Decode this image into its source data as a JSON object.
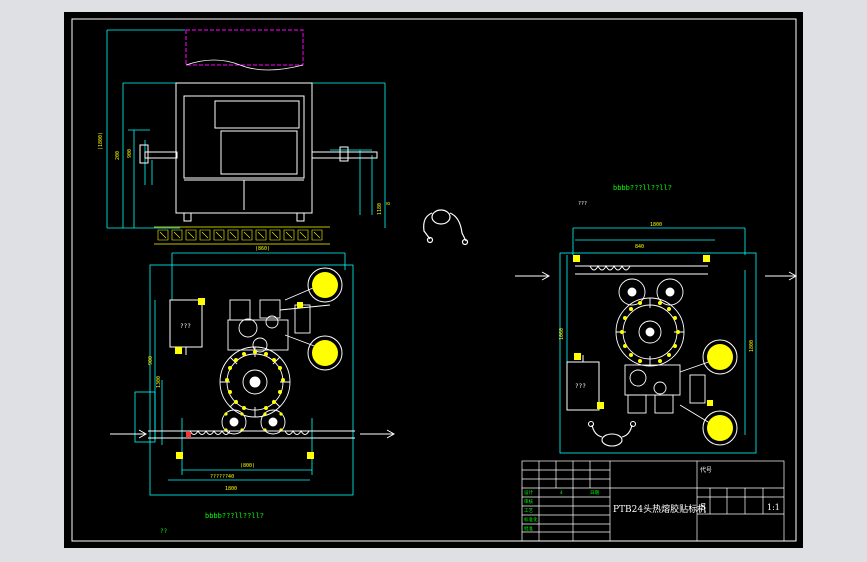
{
  "colors": {
    "background": "#dfe0e4",
    "sheet": "#000000",
    "white": "#ffffff",
    "cyan": "#00ffff",
    "green": "#00ff00",
    "yellow": "#ffff00",
    "magenta": "#ff00ff",
    "red": "#ff3030"
  },
  "drawing": {
    "machine_name": "PTB24头热熔胶贴标机",
    "scale": "1:1",
    "stage_mark": "S",
    "title_block_header": "代号",
    "unknown_label": "???"
  },
  "view_labels": {
    "top_view_right": "bbbb???ll??ll?",
    "top_view_left": "bbbb???ll??ll?",
    "small_left_mark": "??"
  },
  "icons": {
    "operator": "operator-figure-icon",
    "flow_arrow": "flow-arrow-icon",
    "label_roll": "label-roll-icon",
    "star_wheel": "star-wheel-icon"
  }
}
